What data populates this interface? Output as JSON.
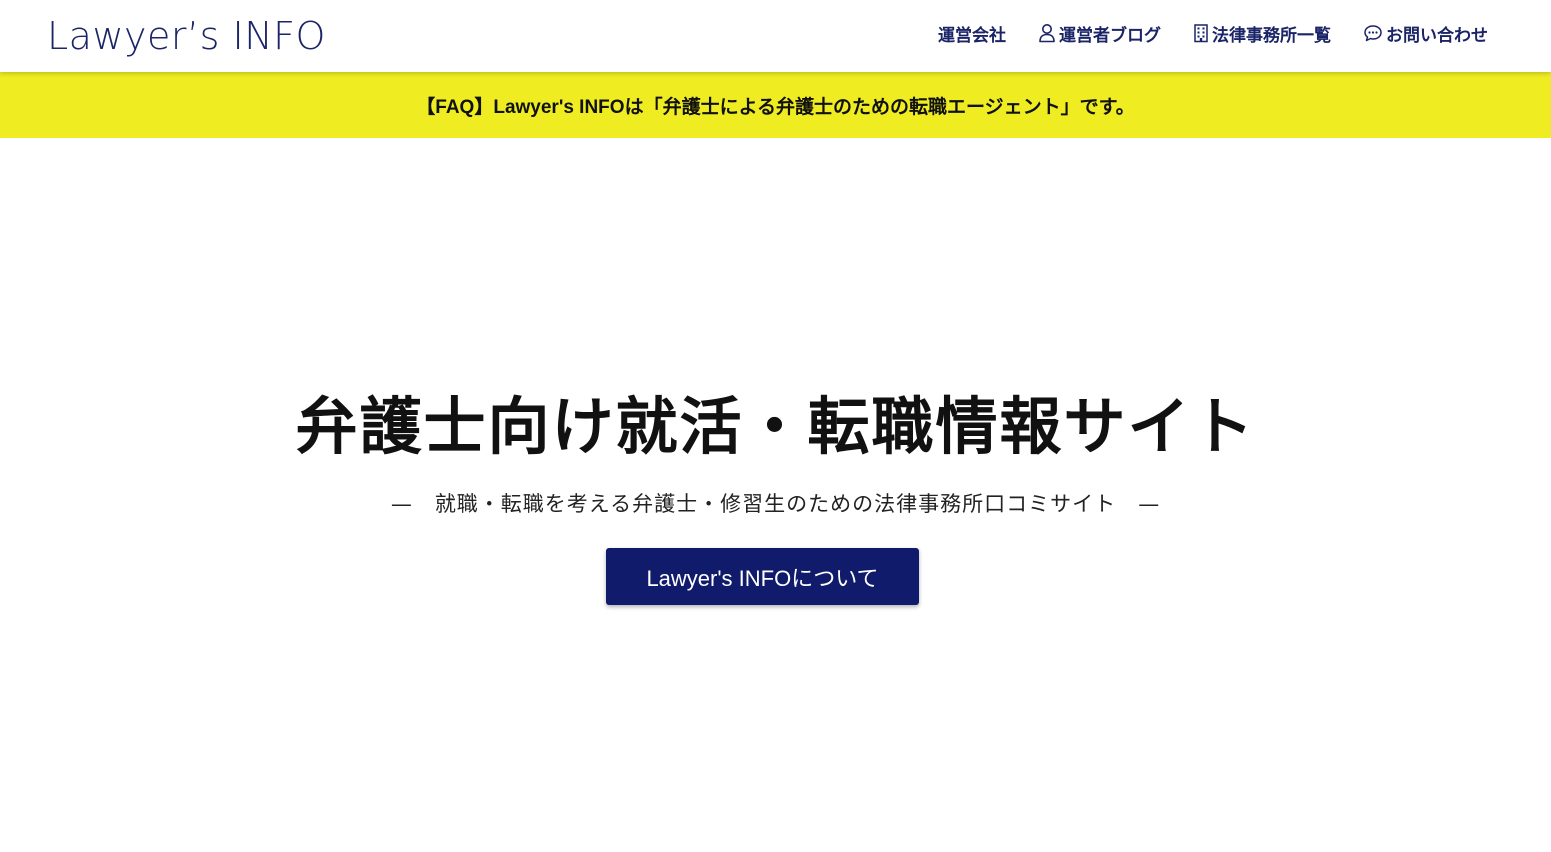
{
  "header": {
    "logo_text": "Lawyer’s INFO",
    "nav": [
      {
        "label": "運営会社",
        "icon": ""
      },
      {
        "label": "運営者ブログ",
        "icon": "user-icon"
      },
      {
        "label": "法律事務所一覧",
        "icon": "building-icon"
      },
      {
        "label": "お問い合わせ",
        "icon": "chat-bubble-icon"
      }
    ]
  },
  "banner": {
    "text": "【FAQ】Lawyer's INFOは「弁護士による弁護士のための転職エージェント」です。",
    "background": "#efed22"
  },
  "hero": {
    "title": "弁護士向け就活・転職情報サイト",
    "subtitle_dash_left": "—",
    "subtitle": "就職・転職を考える弁護士・修習生のための法律事務所口コミサイト",
    "subtitle_dash_right": "—",
    "button_label": "Lawyer's INFOについて"
  },
  "colors": {
    "brand_navy": "#1a2466",
    "button_navy": "#111b6b",
    "banner_yellow": "#efed22"
  }
}
